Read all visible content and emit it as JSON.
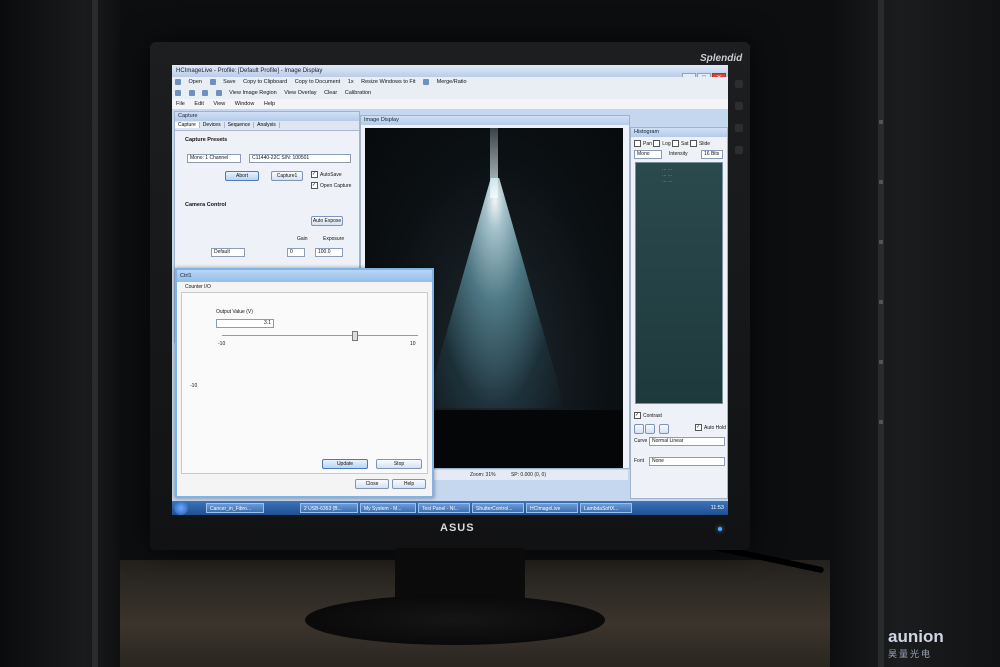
{
  "monitor": {
    "brand_top": "Splendid",
    "brand_bottom": "ASUS"
  },
  "app": {
    "title": "HCImageLive - Profile: [Default Profile] - Image Display",
    "toolbar1": [
      "Open",
      "Save",
      "Copy to Clipboard",
      "Copy to Document",
      "1x",
      "Resize Windows to Fit",
      "Merge/Ratio"
    ],
    "toolbar2": [
      "View Image Region",
      "View Overlay",
      "Clear",
      "Calibration"
    ],
    "menu": [
      "File",
      "Edit",
      "View",
      "Window",
      "Help"
    ]
  },
  "capture": {
    "title": "Capture",
    "tabs": [
      "Capture",
      "Devices",
      "Sequence",
      "Analysis"
    ],
    "presets_header": "Capture Presets",
    "mode": "Mono: 1 Channel",
    "camera": "C11440-22C S/N: 100501",
    "abort": "Abort",
    "capture1": "Capture1",
    "autosave": "AutoSave",
    "open_capture": "Open Capture",
    "camera_control": "Camera Control",
    "auto_expose": "Auto Expose",
    "gain": "Gain",
    "exposure": "Exposure",
    "default": "Default",
    "gain_value": "0",
    "exposure_value": "100.0"
  },
  "image_display": {
    "title": "Image Display",
    "zoom": "Zoom: 31%",
    "coords": "SP: 0.000 (0, 0)"
  },
  "histogram": {
    "title": "Histogram",
    "options": [
      "Pan",
      "Log",
      "Sat",
      "Slide"
    ],
    "mode": "Mono",
    "intensity": "Intensity",
    "bits": "16 Bits",
    "contrast": "Contrast",
    "auto_hold": "Auto Hold",
    "curve_label": "Curve",
    "curve": "Normal Linear",
    "font_label": "Font",
    "font": "None"
  },
  "dialog": {
    "title": "Ctrl1",
    "tab": "Counter I/O",
    "output_label": "Output Value (V)",
    "output_value": "3.1",
    "min": "-10",
    "max": "10",
    "side_value": "-10",
    "update": "Update",
    "stop": "Stop",
    "close": "Close",
    "help": "Help"
  },
  "taskbar": {
    "items": [
      "Cancer_in_Fibro...",
      "2 USB-6363 (B...",
      "My System - M...",
      "Test Panel - NI...",
      "ShutterControl...",
      "HCImageLive",
      "LambdaSoftX..."
    ],
    "time": "11:53"
  },
  "watermark": {
    "name": "aunion",
    "sub": "昊量光电"
  }
}
